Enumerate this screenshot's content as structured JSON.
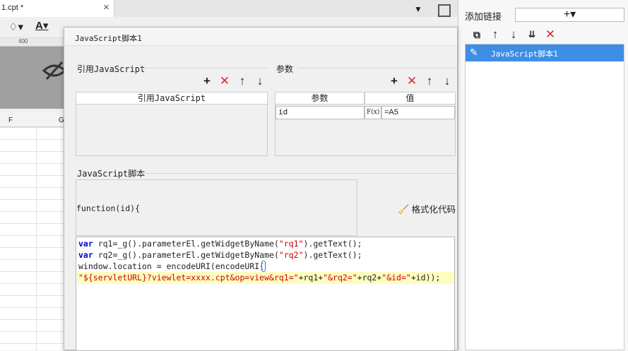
{
  "background": {
    "tab_label": "1.cpt *",
    "tab_close": "×",
    "ruler_number": "400",
    "column_f": "F",
    "column_g": "G"
  },
  "dialog": {
    "title": "JavaScript脚本1",
    "ref_section": {
      "label": "引用JavaScript",
      "column_header": "引用JavaScript"
    },
    "param_section": {
      "label": "参数",
      "columns": [
        "参数",
        "值"
      ],
      "rows": [
        {
          "name": "id",
          "formula_icon": "F(x)",
          "value": "=A5"
        }
      ]
    },
    "script_section": {
      "label": "JavaScript脚本",
      "function_header": "function(id){",
      "format_button": "格式化代码",
      "code": {
        "line1_kw": "var",
        "line1_a": " rq1=_g().parameterEl.getWidgetByName(",
        "line1_str": "\"rq1\"",
        "line1_b": ").getText();",
        "line2_kw": "var",
        "line2_a": " rq2=_g().parameterEl.getWidgetByName(",
        "line2_str": "\"rq2\"",
        "line2_b": ").getText();",
        "line3": "window.location = encodeURI(encodeURI(",
        "line4_s1": "\"${servletURL}?viewlet=xxxx.cpt&op=view&rq1=\"",
        "line4_a": "+rq1+",
        "line4_s2": "\"&rq2=\"",
        "line4_b": "+rq2+",
        "line4_s3": "\"&id=\"",
        "line4_c": "+id));"
      }
    }
  },
  "right_panel": {
    "title": "添加链接",
    "add_symbol": "+▾",
    "items": [
      {
        "label": "JavaScript脚本1",
        "selected": true
      }
    ]
  },
  "colors": {
    "selection": "#3e8ee6",
    "delete_red": "#e0262c",
    "keyword_blue": "#0000d0",
    "string_red": "#d10000",
    "current_line": "#fdfdc0"
  },
  "icons": {
    "add": "+",
    "delete": "✕",
    "up": "↑",
    "down": "↓",
    "broom": "🧹",
    "edit": "✎"
  }
}
